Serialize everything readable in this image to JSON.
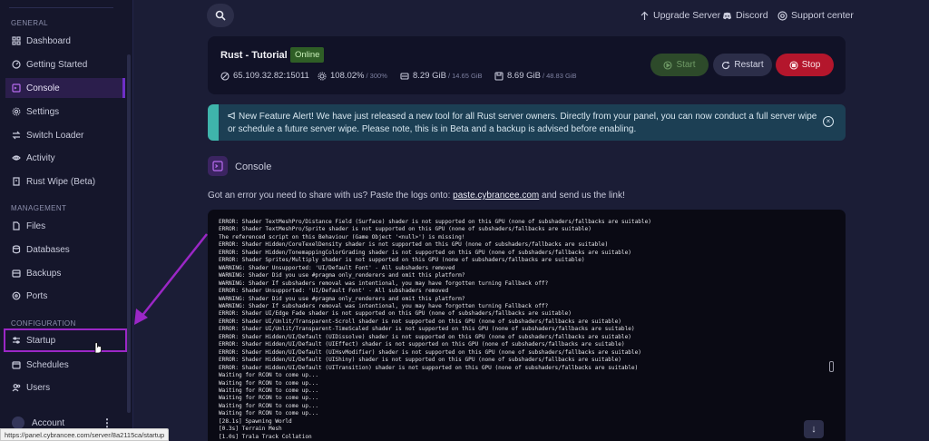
{
  "sidebar": {
    "sections": [
      {
        "label": "GENERAL",
        "items": [
          {
            "label": "Dashboard",
            "icon": "grid-icon"
          },
          {
            "label": "Getting Started",
            "icon": "gauge-icon"
          },
          {
            "label": "Console",
            "icon": "terminal-icon",
            "active": true
          },
          {
            "label": "Settings",
            "icon": "gear-icon"
          },
          {
            "label": "Switch Loader",
            "icon": "switch-icon"
          },
          {
            "label": "Activity",
            "icon": "eye-icon"
          },
          {
            "label": "Rust Wipe (Beta)",
            "icon": "rust-icon"
          }
        ]
      },
      {
        "label": "MANAGEMENT",
        "items": [
          {
            "label": "Files",
            "icon": "file-icon"
          },
          {
            "label": "Databases",
            "icon": "database-icon"
          },
          {
            "label": "Backups",
            "icon": "backup-icon"
          },
          {
            "label": "Ports",
            "icon": "ports-icon"
          }
        ]
      },
      {
        "label": "CONFIGURATION",
        "items": [
          {
            "label": "Startup",
            "icon": "sliders-icon",
            "highlighted": true
          },
          {
            "label": "Schedules",
            "icon": "calendar-icon"
          },
          {
            "label": "Users",
            "icon": "users-icon"
          }
        ]
      }
    ],
    "account_label": "Account",
    "account_menu": "⋮"
  },
  "status_url": "https://panel.cybrancee.com/server/8a2115ca/startup",
  "topbar": {
    "upgrade": "Upgrade Server",
    "discord": "Discord",
    "support": "Support center"
  },
  "server": {
    "name": "Rust - Tutorial",
    "status": "Online",
    "address": "65.109.32.82:15011",
    "cpu": "108.02%",
    "cpu_limit": "/ 300%",
    "memory": "8.29 GiB",
    "memory_limit": "/ 14.65 GiB",
    "disk": "8.69 GiB",
    "disk_limit": "/ 48.83 GiB",
    "start_label": "Start",
    "restart_label": "Restart",
    "stop_label": "Stop"
  },
  "alert": {
    "text": "New Feature Alert! We have just released a new tool for all Rust server owners. Directly from your panel, you can now conduct a full server wipe or schedule a future server wipe. Please note, this is in Beta and a backup is advised before enabling."
  },
  "console": {
    "title": "Console",
    "share_prefix": "Got an error you need to share with us? Paste the logs onto:",
    "share_link": "paste.cybrancee.com",
    "share_suffix": "and send us the link!",
    "lines": [
      "ERROR: Shader TextMeshPro/Distance Field (Surface) shader is not supported on this GPU (none of subshaders/fallbacks are suitable)",
      "ERROR: Shader TextMeshPro/Sprite shader is not supported on this GPU (none of subshaders/fallbacks are suitable)",
      "The referenced script on this Behaviour (Game Object '<null>') is missing!",
      "ERROR: Shader Hidden/CoreTexelDensity shader is not supported on this GPU (none of subshaders/fallbacks are suitable)",
      "ERROR: Shader Hidden/TonemappingColorGrading shader is not supported on this GPU (none of subshaders/fallbacks are suitable)",
      "ERROR: Shader Sprites/Multiply shader is not supported on this GPU (none of subshaders/fallbacks are suitable)",
      "WARNING: Shader Unsupported: 'UI/Default Font' - All subshaders removed",
      "WARNING: Shader Did you use #pragma only_renderers and omit this platform?",
      "WARNING: Shader If subshaders removal was intentional, you may have forgotten turning Fallback off?",
      "ERROR: Shader Unsupported: 'UI/Default Font' - All subshaders removed",
      "WARNING: Shader Did you use #pragma only_renderers and omit this platform?",
      "WARNING: Shader If subshaders removal was intentional, you may have forgotten turning Fallback off?",
      "ERROR: Shader UI/Edge Fade shader is not supported on this GPU (none of subshaders/fallbacks are suitable)",
      "ERROR: Shader UI/Unlit/Transparent-Scroll shader is not supported on this GPU (none of subshaders/fallbacks are suitable)",
      "ERROR: Shader UI/Unlit/Transparent-TimeScaled shader is not supported on this GPU (none of subshaders/fallbacks are suitable)",
      "ERROR: Shader Hidden/UI/Default (UIDissolve) shader is not supported on this GPU (none of subshaders/fallbacks are suitable)",
      "ERROR: Shader Hidden/UI/Default (UIEffect) shader is not supported on this GPU (none of subshaders/fallbacks are suitable)",
      "ERROR: Shader Hidden/UI/Default (UIHsvModifier) shader is not supported on this GPU (none of subshaders/fallbacks are suitable)",
      "ERROR: Shader Hidden/UI/Default (UIShiny) shader is not supported on this GPU (none of subshaders/fallbacks are suitable)",
      "ERROR: Shader Hidden/UI/Default (UITransition) shader is not supported on this GPU (none of subshaders/fallbacks are suitable)",
      "Waiting for RCON to come up...",
      "Waiting for RCON to come up...",
      "Waiting for RCON to come up...",
      "Waiting for RCON to come up...",
      "Waiting for RCON to come up...",
      "Waiting for RCON to come up...",
      "[28.1s] Spawning World",
      "[0.3s] Terrain Mesh",
      "[1.0s] Trala Track Collation"
    ]
  },
  "colors": {
    "background": "#1b1d36",
    "sidebar": "#15162b",
    "accent_purple": "#9b27c6",
    "online_green": "#2f5e26",
    "stop_red": "#b4162c",
    "alert_teal": "#3fb4ab"
  }
}
